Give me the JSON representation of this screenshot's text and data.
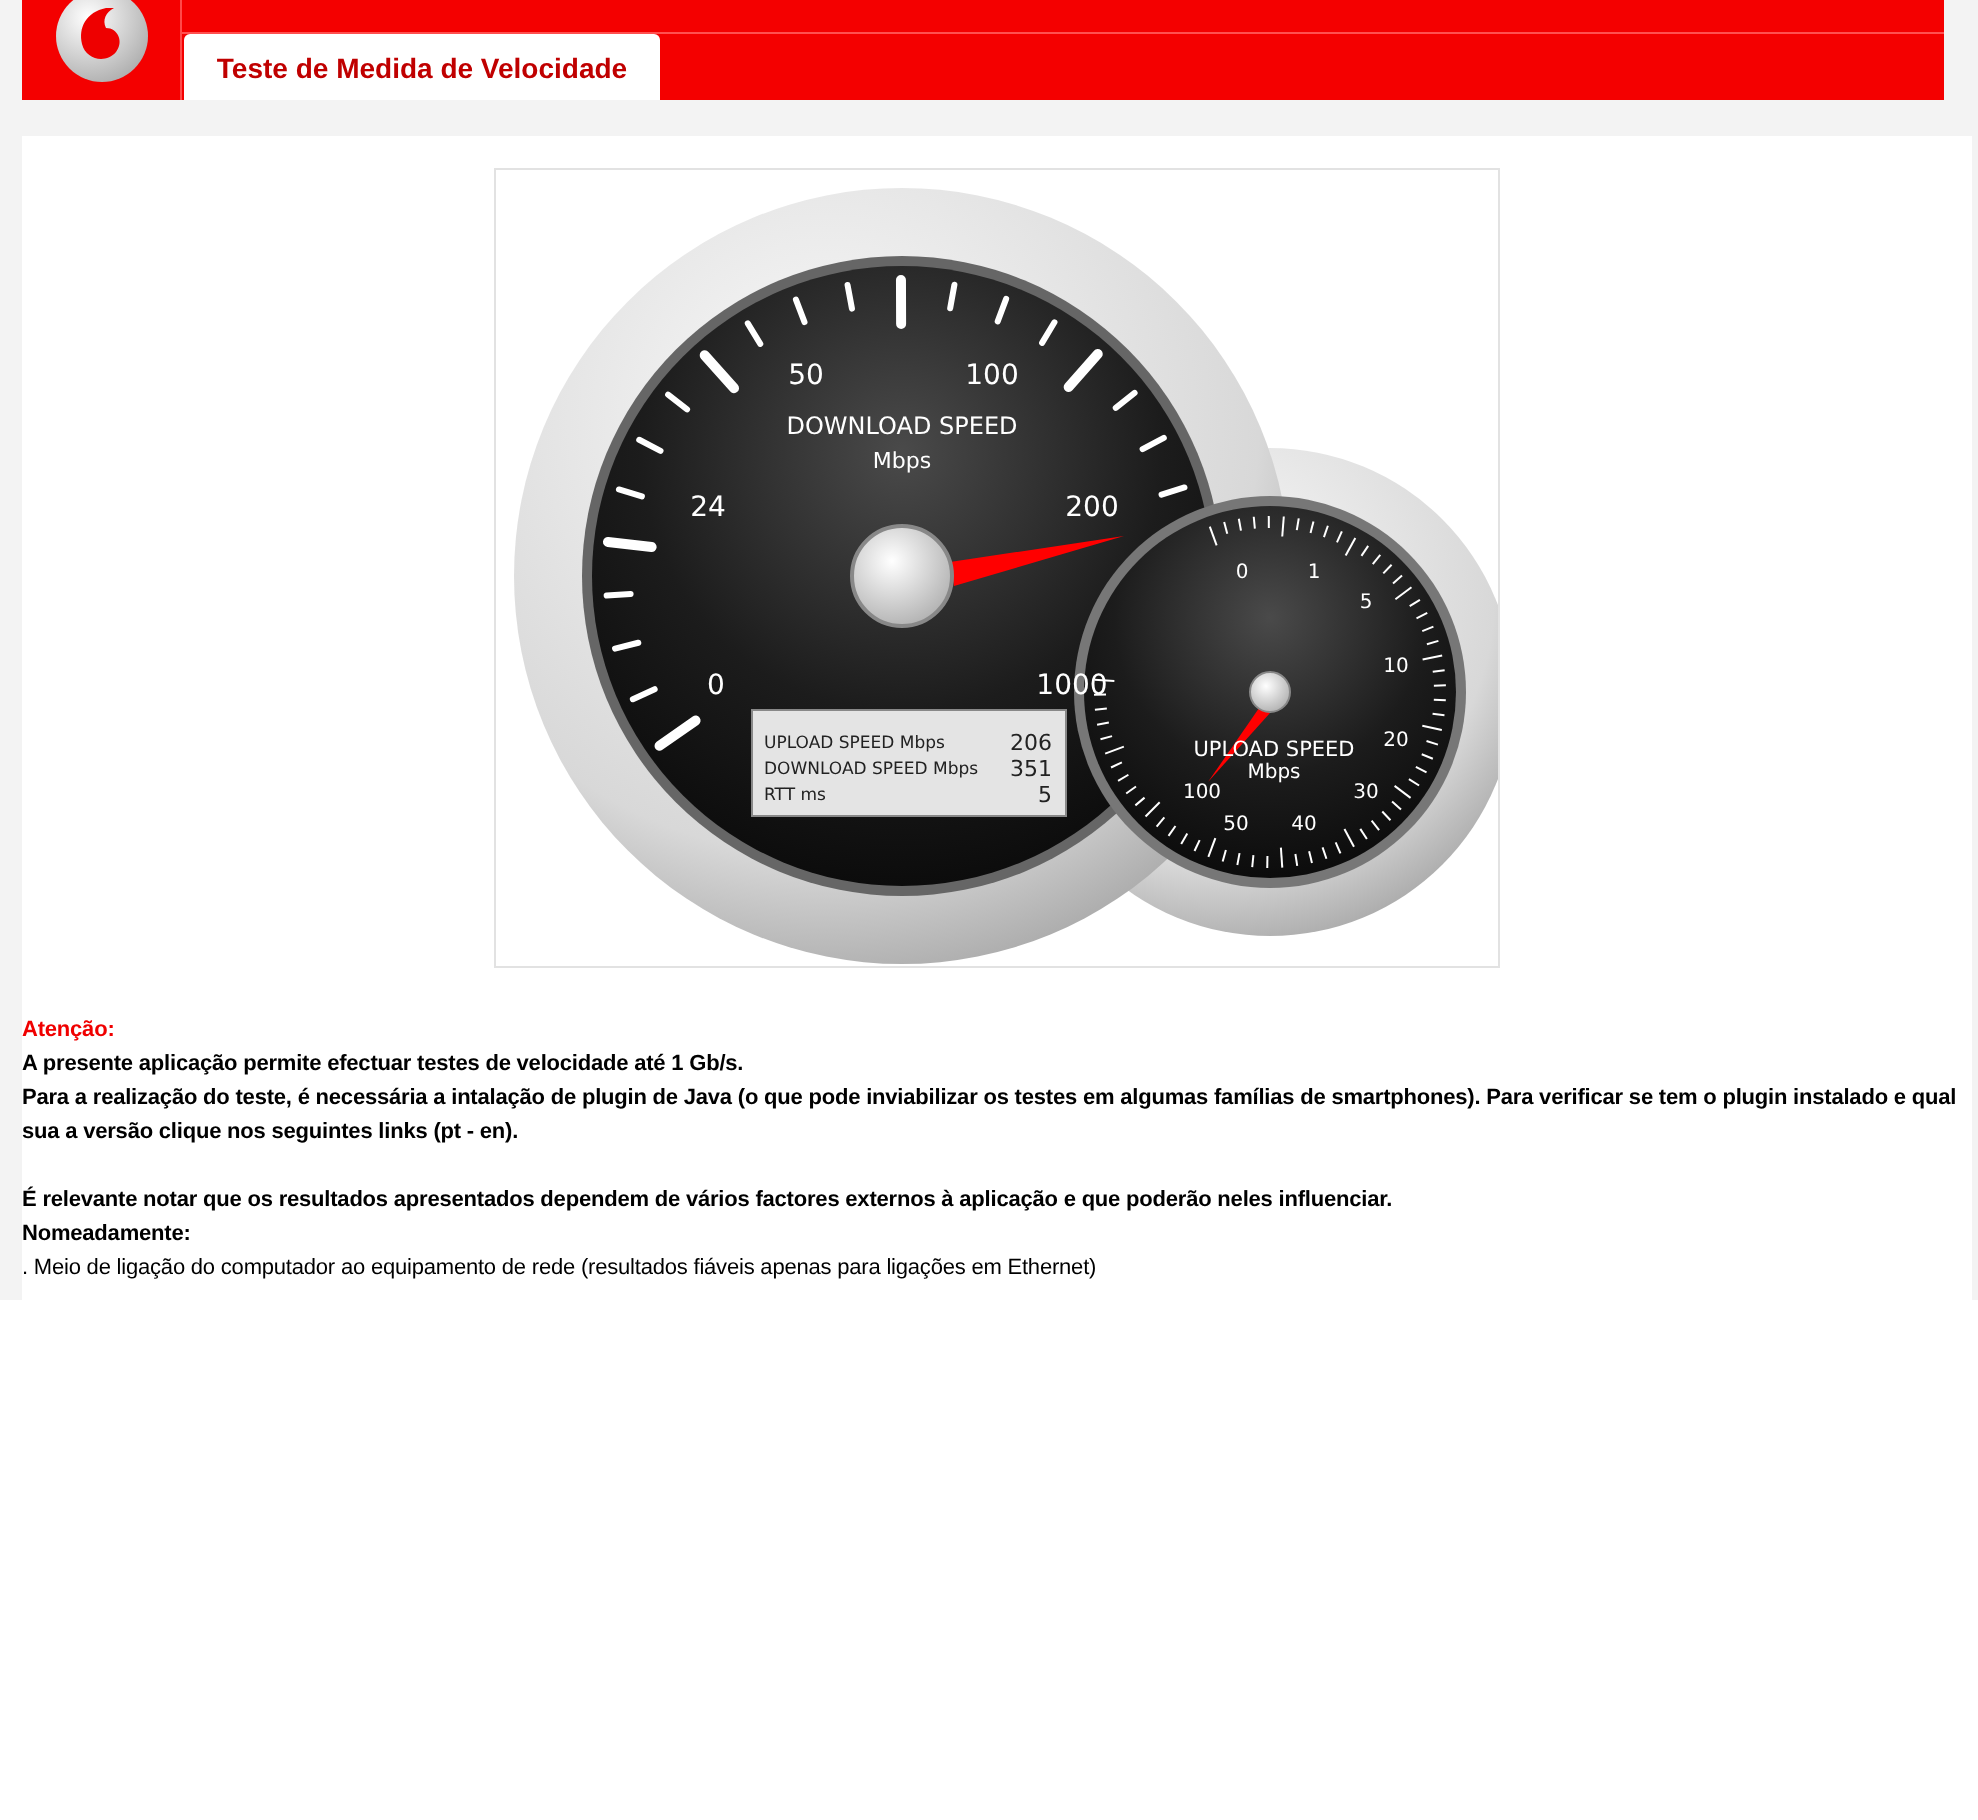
{
  "header": {
    "tabs": [
      {
        "label": "Teste de Medida de Velocidade",
        "selected": true
      }
    ]
  },
  "gauge": {
    "download": {
      "title": "DOWNLOAD SPEED",
      "unit": "Mbps",
      "scale": [
        "0",
        "24",
        "50",
        "100",
        "200",
        "1000"
      ]
    },
    "upload": {
      "title": "UPLOAD SPEED",
      "unit": "Mbps",
      "scale": [
        "0",
        "1",
        "5",
        "10",
        "20",
        "30",
        "40",
        "50",
        "100"
      ]
    },
    "readout": [
      {
        "label": "UPLOAD SPEED Mbps",
        "value": "206"
      },
      {
        "label": "DOWNLOAD SPEED Mbps",
        "value": "351"
      },
      {
        "label": "RTT ms",
        "value": "5"
      }
    ]
  },
  "notice": {
    "heading": "Atenção:",
    "paragraphs": [
      {
        "kind": "bold",
        "text": "A presente aplicação permite efectuar testes de velocidade até 1 Gb/s."
      },
      {
        "kind": "bold",
        "text": "Para a realização do teste, é necessária a intalação de plugin de Java (o que pode inviabilizar os testes em algumas famílias de smartphones). Para verificar se tem o plugin instalado e qual sua a versão clique nos seguintes links (pt - en)."
      },
      {
        "kind": "gap"
      },
      {
        "kind": "bold",
        "text": "É relevante notar que os resultados apresentados dependem de vários factores externos à aplicação e que poderão neles influenciar."
      },
      {
        "kind": "bold",
        "text": "Nomeadamente:"
      },
      {
        "kind": "plain",
        "text": ". Meio de ligação do computador ao equipamento de rede (resultados fiáveis apenas para ligações em Ethernet)"
      }
    ]
  }
}
